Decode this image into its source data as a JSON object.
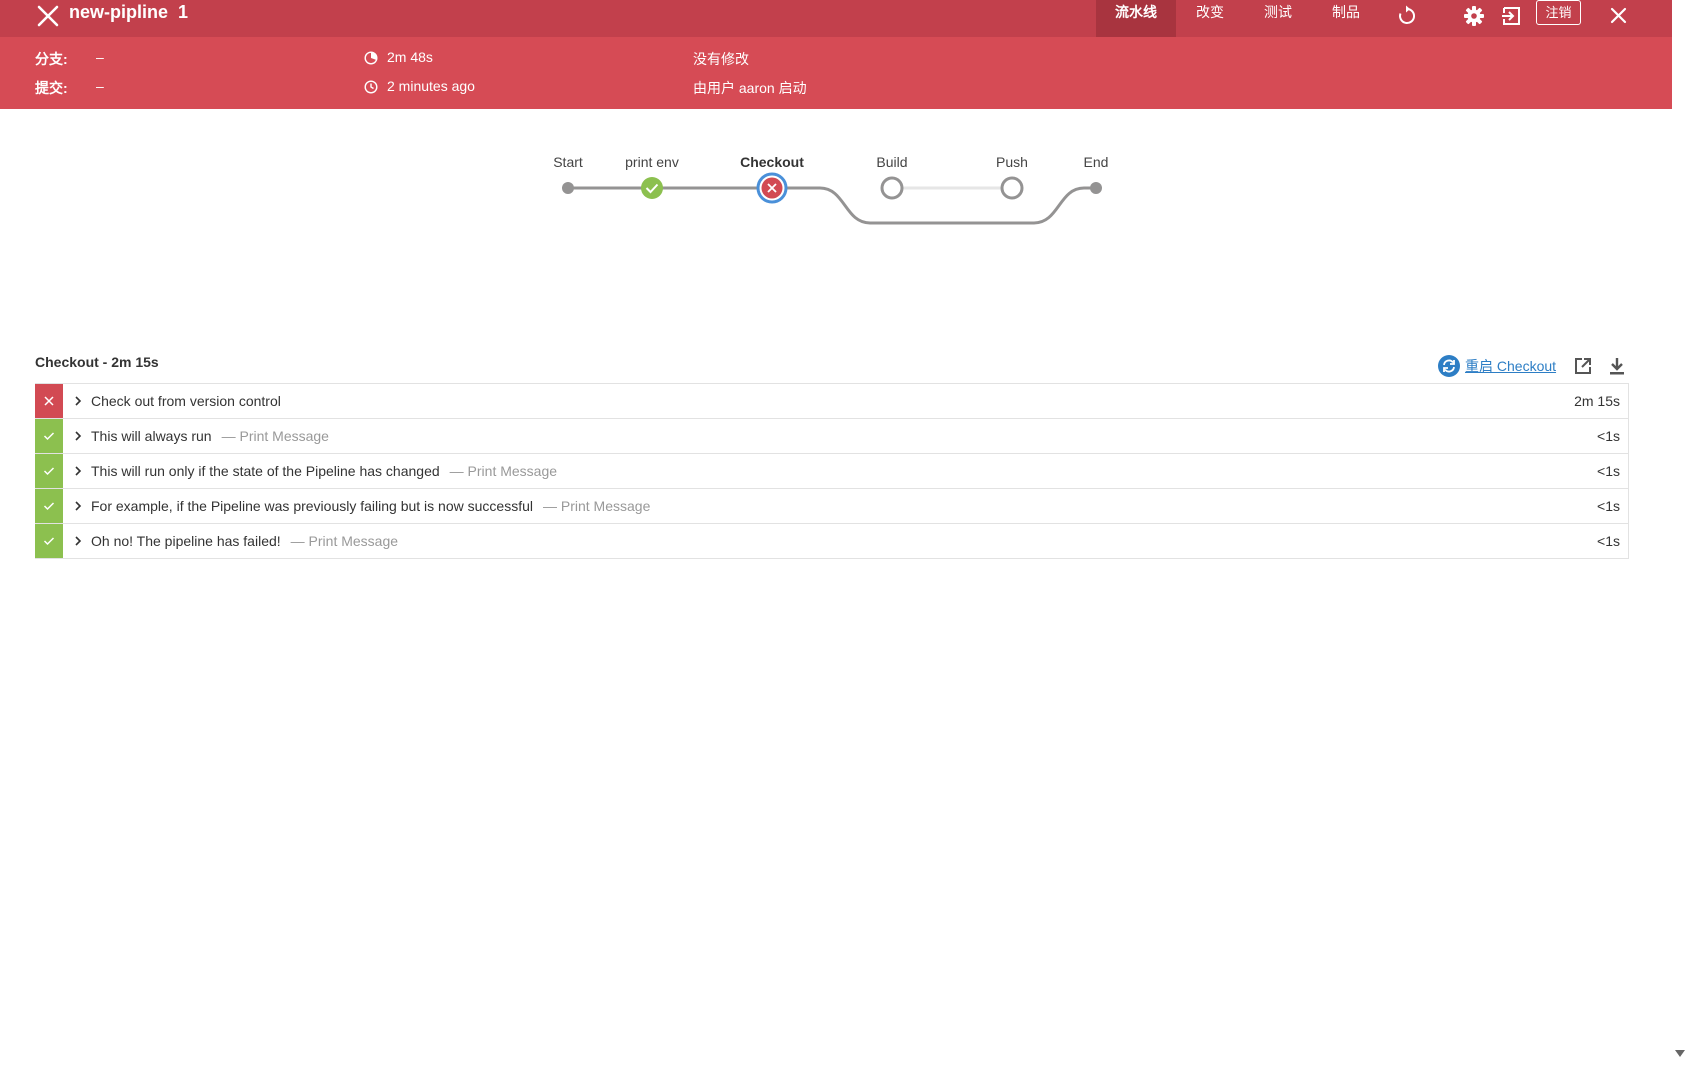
{
  "header": {
    "pipeline_name": "new-pipline",
    "run_number": "1",
    "tabs": [
      {
        "label": "流水线",
        "active": true
      },
      {
        "label": "改变",
        "active": false
      },
      {
        "label": "测试",
        "active": false
      },
      {
        "label": "制品",
        "active": false
      }
    ],
    "logout_label": "注销",
    "icons": [
      "close-icon",
      "replay-icon",
      "gear-icon",
      "exit-icon",
      "close-icon"
    ]
  },
  "run_info": {
    "branch_label": "分支:",
    "branch_value": "–",
    "commit_label": "提交:",
    "commit_value": "–",
    "duration": "2m 48s",
    "started": "2 minutes ago",
    "changes": "没有修改",
    "started_by": "由用户 aaron 启动"
  },
  "pipeline_graph": {
    "stages": [
      {
        "label": "Start",
        "status": "terminal"
      },
      {
        "label": "print env",
        "status": "success"
      },
      {
        "label": "Checkout",
        "status": "failed",
        "selected": true
      },
      {
        "label": "Build",
        "status": "not_built"
      },
      {
        "label": "Push",
        "status": "not_built"
      },
      {
        "label": "End",
        "status": "terminal"
      }
    ]
  },
  "steps_panel": {
    "title": "Checkout - 2m 15s",
    "restart_label": "重启 Checkout",
    "steps": [
      {
        "text": "Check out from version control",
        "sub": "",
        "duration": "2m 15s",
        "status": "failed"
      },
      {
        "text": "This will always run",
        "sub": "— Print Message",
        "duration": "<1s",
        "status": "success"
      },
      {
        "text": "This will run only if the state of the Pipeline has changed",
        "sub": "— Print Message",
        "duration": "<1s",
        "status": "success"
      },
      {
        "text": "For example, if the Pipeline was previously failing but is now successful",
        "sub": "— Print Message",
        "duration": "<1s",
        "status": "success"
      },
      {
        "text": "Oh no! The pipeline has failed!",
        "sub": "— Print Message",
        "duration": "<1s",
        "status": "success"
      }
    ]
  },
  "colors": {
    "header_dark": "#c2404c",
    "header_light": "#d64b55",
    "active_tab": "#a8343f",
    "failed": "#d24a53",
    "success": "#8cc04f",
    "link": "#2d7ec5",
    "graph_line": "#949393"
  }
}
